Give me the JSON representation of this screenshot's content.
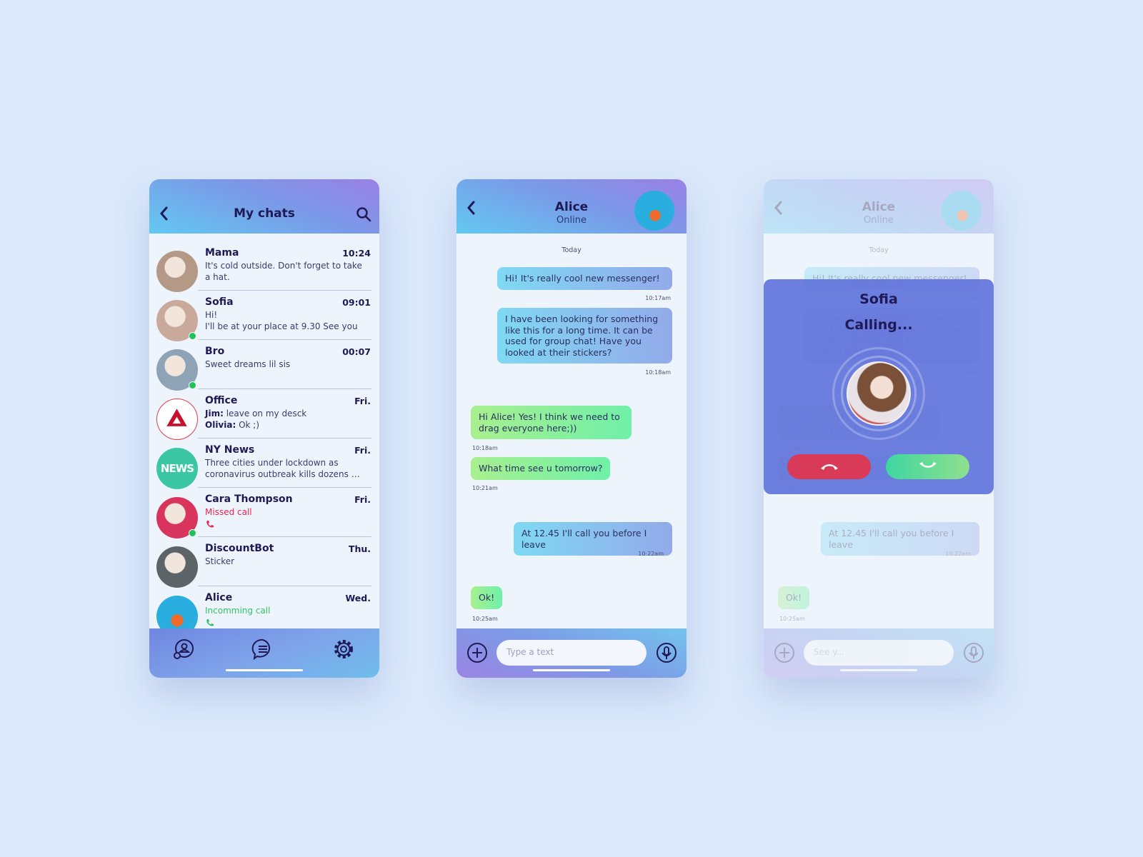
{
  "chats_screen": {
    "title": "My chats",
    "back_icon": "chevron-left-icon",
    "search_icon": "search-icon",
    "items": [
      {
        "name": "Mama",
        "time": "10:24",
        "preview": "It's cold outside. Don't forget to take a hat.",
        "online": false,
        "avatar_color": "#b49a86"
      },
      {
        "name": "Sofia",
        "time": "09:01",
        "preview": "Hi!\nI'll be at your place at 9.30 See you",
        "online": true,
        "avatar_color": "#c9a99a"
      },
      {
        "name": "Bro",
        "time": "00:07",
        "preview": "Sweet dreams lil sis",
        "online": true,
        "avatar_color": "#8ea3b5"
      },
      {
        "name": "Office",
        "time": "Fri.",
        "lines": [
          {
            "sender": "Jim:",
            "text": " leave on my desck"
          },
          {
            "sender": "Olivia:",
            "text": " Ok ;)"
          }
        ],
        "online": false,
        "avatar_color": "#ffffff"
      },
      {
        "name": "NY News",
        "time": "Fri.",
        "preview": "Three cities under lockdown as coronavirus outbreak kills dozens …",
        "online": false,
        "avatar_color": "#3cc7a4"
      },
      {
        "name": "Cara Thompson",
        "time": "Fri.",
        "status": "Missed call",
        "status_color": "#e8264f",
        "online": true,
        "avatar_color": "#d8345e"
      },
      {
        "name": "DiscountBot",
        "time": "Thu.",
        "preview": "Sticker",
        "online": false,
        "avatar_color": "#5c6468"
      },
      {
        "name": "Alice",
        "time": "Wed.",
        "status": "Incomming call",
        "status_color": "#2fc46a",
        "online": false,
        "avatar_color": "#2aaee0"
      }
    ],
    "nav": [
      {
        "icon": "contacts-icon"
      },
      {
        "icon": "chats-icon"
      },
      {
        "icon": "settings-gear-icon"
      }
    ]
  },
  "conversation": {
    "contact_name": "Alice",
    "contact_status": "Online",
    "day_label": "Today",
    "messages": [
      {
        "from": "me",
        "text": "Hi! It's really cool new messenger!",
        "time": "10:17am"
      },
      {
        "from": "me",
        "text": "I have been looking for something like this for a long time. It can be used for group chat! Have you looked at their stickers?",
        "time": "10:18am"
      },
      {
        "from": "them",
        "text": "Hi Alice! Yes! I think we need to drag everyone here;))",
        "time": "10:18am"
      },
      {
        "from": "them",
        "text": "What time see u tomorrow?",
        "time": "10:21am"
      },
      {
        "from": "me",
        "text": "At 12.45 I'll call you before I leave",
        "time": "10:22am"
      },
      {
        "from": "them",
        "text": "Ok!",
        "time": "10:25am"
      }
    ],
    "input_placeholder": "Type a text",
    "colors": {
      "outgoing": "#8ac4ef",
      "incoming": "#8ef0a0"
    }
  },
  "call_screen": {
    "caller": "Sofia",
    "status": "Calling...",
    "input_value": "See y...",
    "decline_color": "#d83a58",
    "accept_color": "#4fd89a"
  }
}
